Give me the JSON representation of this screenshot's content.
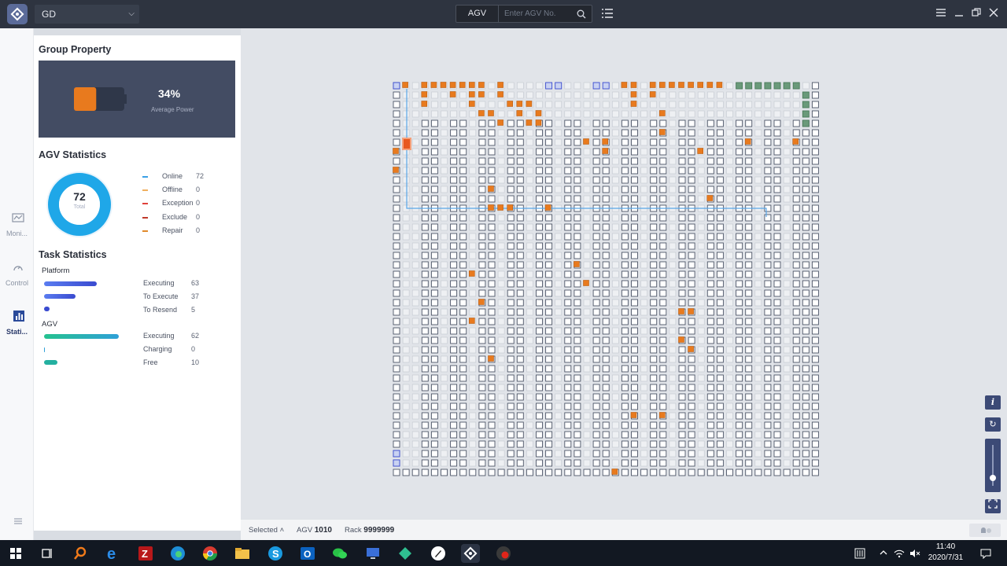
{
  "titlebar": {
    "group_value": "GD",
    "search_type": "AGV",
    "search_placeholder": "Enter AGV No."
  },
  "nav": [
    {
      "label": "Moni...",
      "icon": "monitor-icon"
    },
    {
      "label": "Control",
      "icon": "control-icon"
    },
    {
      "label": "Stati...",
      "icon": "statistics-icon",
      "active": true
    }
  ],
  "group_property": {
    "title": "Group Property",
    "power_value": "34%",
    "power_label": "Average Power",
    "power_fraction": 0.34
  },
  "agv_statistics": {
    "title": "AGV Statistics",
    "total": "72",
    "total_label": "Total",
    "legend": [
      {
        "name": "Online",
        "value": "72",
        "color": "#3aa0e6"
      },
      {
        "name": "Offline",
        "value": "0",
        "color": "#f0b060"
      },
      {
        "name": "Exception",
        "value": "0",
        "color": "#e0413a"
      },
      {
        "name": "Exclude",
        "value": "0",
        "color": "#c0392b"
      },
      {
        "name": "Repair",
        "value": "0",
        "color": "#e08a2c"
      }
    ]
  },
  "task_statistics": {
    "title": "Task Statistics",
    "platform_label": "Platform",
    "platform": [
      {
        "name": "Executing",
        "value": "63",
        "fraction": 0.63
      },
      {
        "name": "To Execute",
        "value": "37",
        "fraction": 0.37
      },
      {
        "name": "To Resend",
        "value": "5",
        "fraction": 0.05
      }
    ],
    "agv_label": "AGV",
    "agv": [
      {
        "name": "Executing",
        "value": "62",
        "fraction": 0.62
      },
      {
        "name": "Charging",
        "value": "0",
        "fraction": 0.0
      },
      {
        "name": "Free",
        "value": "10",
        "fraction": 0.1
      }
    ]
  },
  "statusbar": {
    "selected_label": "Selected",
    "agv_label": "AGV",
    "agv_value": "1010",
    "rack_label": "Rack",
    "rack_value": "9999999"
  },
  "clock": {
    "time": "11:40",
    "date": "2020/7/31"
  },
  "colors": {
    "accent": "#3c4a76",
    "agv_orange": "#e87a1e",
    "path_blue": "#5aa7e8",
    "charger_green": "#5a9a6a"
  }
}
